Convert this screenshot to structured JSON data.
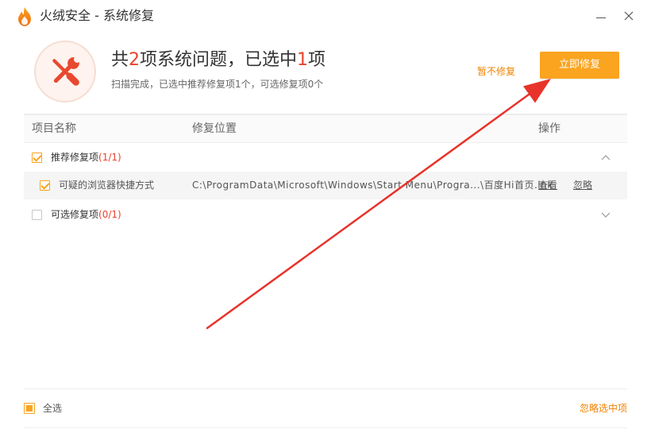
{
  "window": {
    "title": "火绒安全 - 系统修复"
  },
  "icons": {
    "logo": "huorong-flame-logo-icon",
    "minimize": "minimize-icon",
    "close": "close-icon",
    "summary": "repair-tools-icon",
    "collapse": "chevron-up-icon",
    "expand": "chevron-down-icon"
  },
  "summary": {
    "headline": {
      "prefix": "共",
      "total": "2",
      "middle": "项系统问题，已选中",
      "selected": "1",
      "suffix": "项"
    },
    "subtitle": "扫描完成，已选中推荐修复项1个，可选修复项0个"
  },
  "actions": {
    "skip_label": "暂不修复",
    "repair_label": "立即修复"
  },
  "table": {
    "columns": [
      "项目名称",
      "修复位置",
      "操作"
    ],
    "groups": [
      {
        "label": "推荐修复项",
        "count": "(1/1)",
        "checked": true,
        "expanded": true,
        "items": [
          {
            "name": "可疑的浏览器快捷方式",
            "path": "C:\\ProgramData\\Microsoft\\Windows\\Start Menu\\Progra...\\百度Hi首页.lnk",
            "checked": true,
            "view_label": "查看",
            "ignore_label": "忽略"
          }
        ]
      },
      {
        "label": "可选修复项",
        "count": "(0/1)",
        "checked": false,
        "expanded": false,
        "items": []
      }
    ]
  },
  "footer": {
    "select_all": {
      "label": "全选",
      "checked": false,
      "indeterminate": true
    },
    "ignore_selected_label": "忽略选中项"
  },
  "colors": {
    "accent": "#faa41f",
    "link": "#f08300",
    "highlight": "#e8432c",
    "arrow": "#e8332a",
    "tool_icon": "#e8492f"
  }
}
